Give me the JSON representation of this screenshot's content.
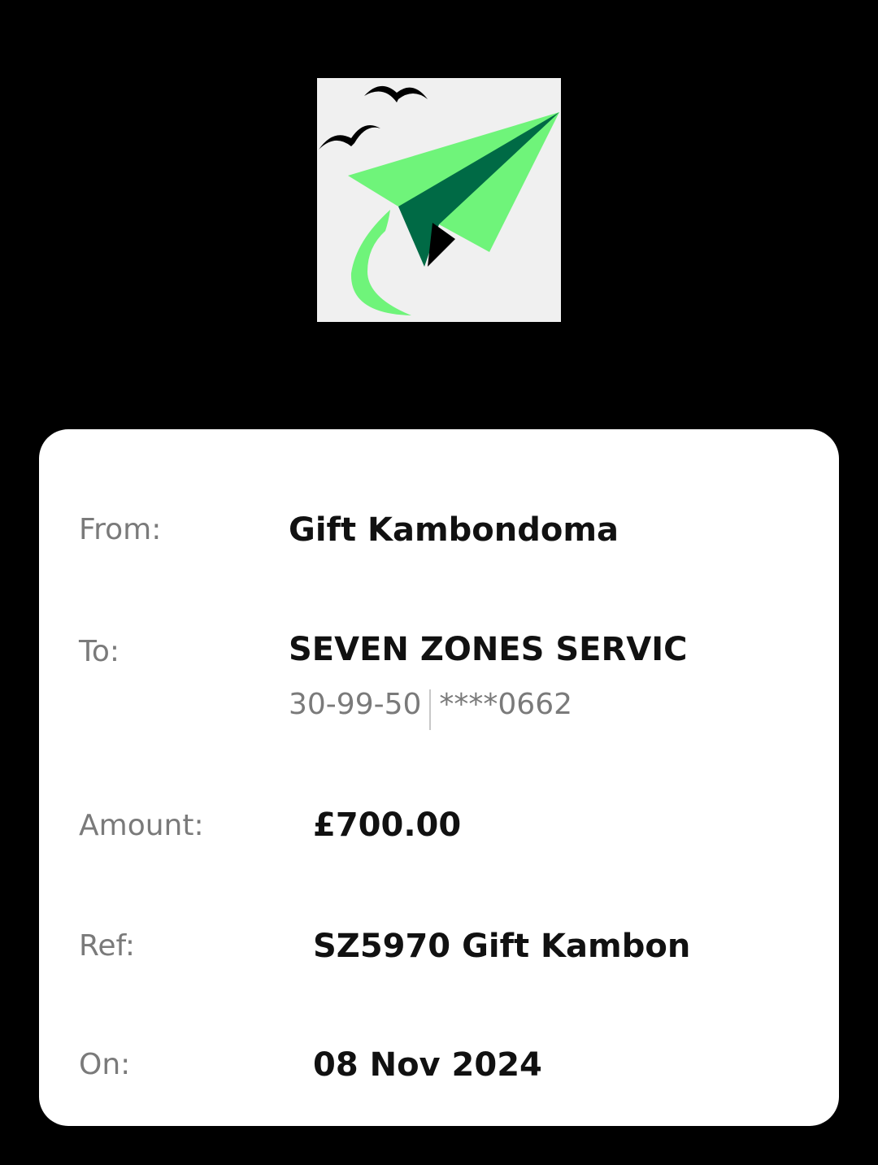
{
  "logo": {
    "icon": "paper-plane-with-birds-icon",
    "colors": {
      "background": "#f0f0f0",
      "light_green": "#6ff47a",
      "dark_green": "#006a45",
      "black": "#000000"
    }
  },
  "receipt": {
    "from_label": "From:",
    "from_value": "Gift Kambondoma",
    "to_label": "To:",
    "to_value": "SEVEN ZONES SERVIC",
    "sort_code": "30-99-50",
    "account_masked": "****0662",
    "amount_label": "Amount:",
    "amount_value": "£700.00",
    "ref_label": "Ref:",
    "ref_value": "SZ5970 Gift Kambon",
    "on_label": "On:",
    "on_value": "08 Nov 2024"
  }
}
